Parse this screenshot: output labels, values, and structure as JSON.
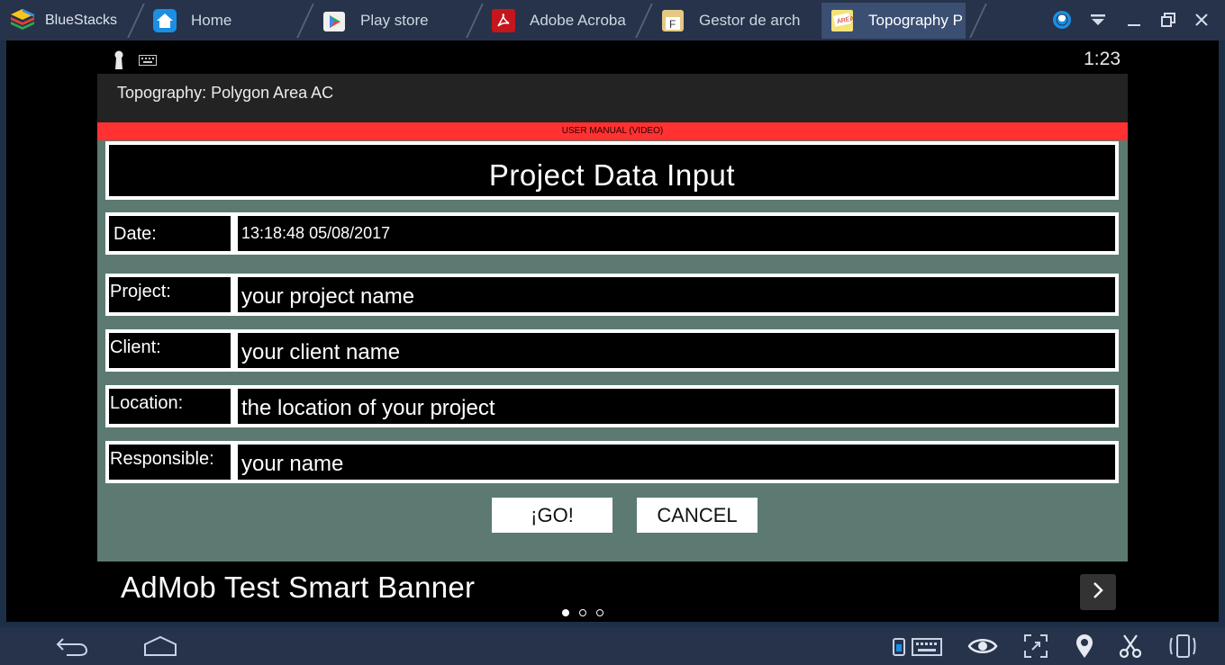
{
  "window": {
    "brand": "BlueStacks",
    "tabs": [
      {
        "label": "Home",
        "icon": "home-icon"
      },
      {
        "label": "Play store",
        "icon": "play-store-icon"
      },
      {
        "label": "Adobe Acroba",
        "icon": "adobe-acrobat-icon"
      },
      {
        "label": "Gestor de arch",
        "icon": "file-manager-icon"
      },
      {
        "label": "Topography  P",
        "icon": "topography-app-icon",
        "active": true
      }
    ],
    "controls": [
      "account-icon",
      "dropdown-icon",
      "minimize-icon",
      "restore-icon",
      "close-icon"
    ]
  },
  "status": {
    "time": "1:23",
    "icons": [
      "keyhole-icon",
      "keyboard-icon"
    ]
  },
  "app": {
    "title": "Topography: Polygon Area AC",
    "manual_link": "USER MANUAL (VIDEO)"
  },
  "form": {
    "heading": "Project Data Input",
    "date": {
      "label": "Date:",
      "value": "13:18:48 05/08/2017"
    },
    "fields": [
      {
        "label": "Project:",
        "value": "your project name"
      },
      {
        "label": "Client:",
        "value": "your client name"
      },
      {
        "label": "Location:",
        "value": "the location of your project"
      },
      {
        "label": "Responsible:",
        "value": "your name"
      }
    ],
    "go_label": "¡GO!",
    "cancel_label": "CANCEL"
  },
  "ad": {
    "text": "AdMob Test Smart Banner",
    "page_index": 1,
    "page_count": 3
  },
  "navbar": {
    "left": [
      "back-icon",
      "home-icon"
    ],
    "right": [
      "keymapping-icon",
      "eye-icon",
      "fullscreen-icon",
      "location-icon",
      "scissors-icon",
      "rotate-device-icon"
    ]
  },
  "colors": {
    "accent_red": "#ff3131",
    "form_background": "#5c7a72",
    "bluestacks_chrome": "#26334a"
  }
}
